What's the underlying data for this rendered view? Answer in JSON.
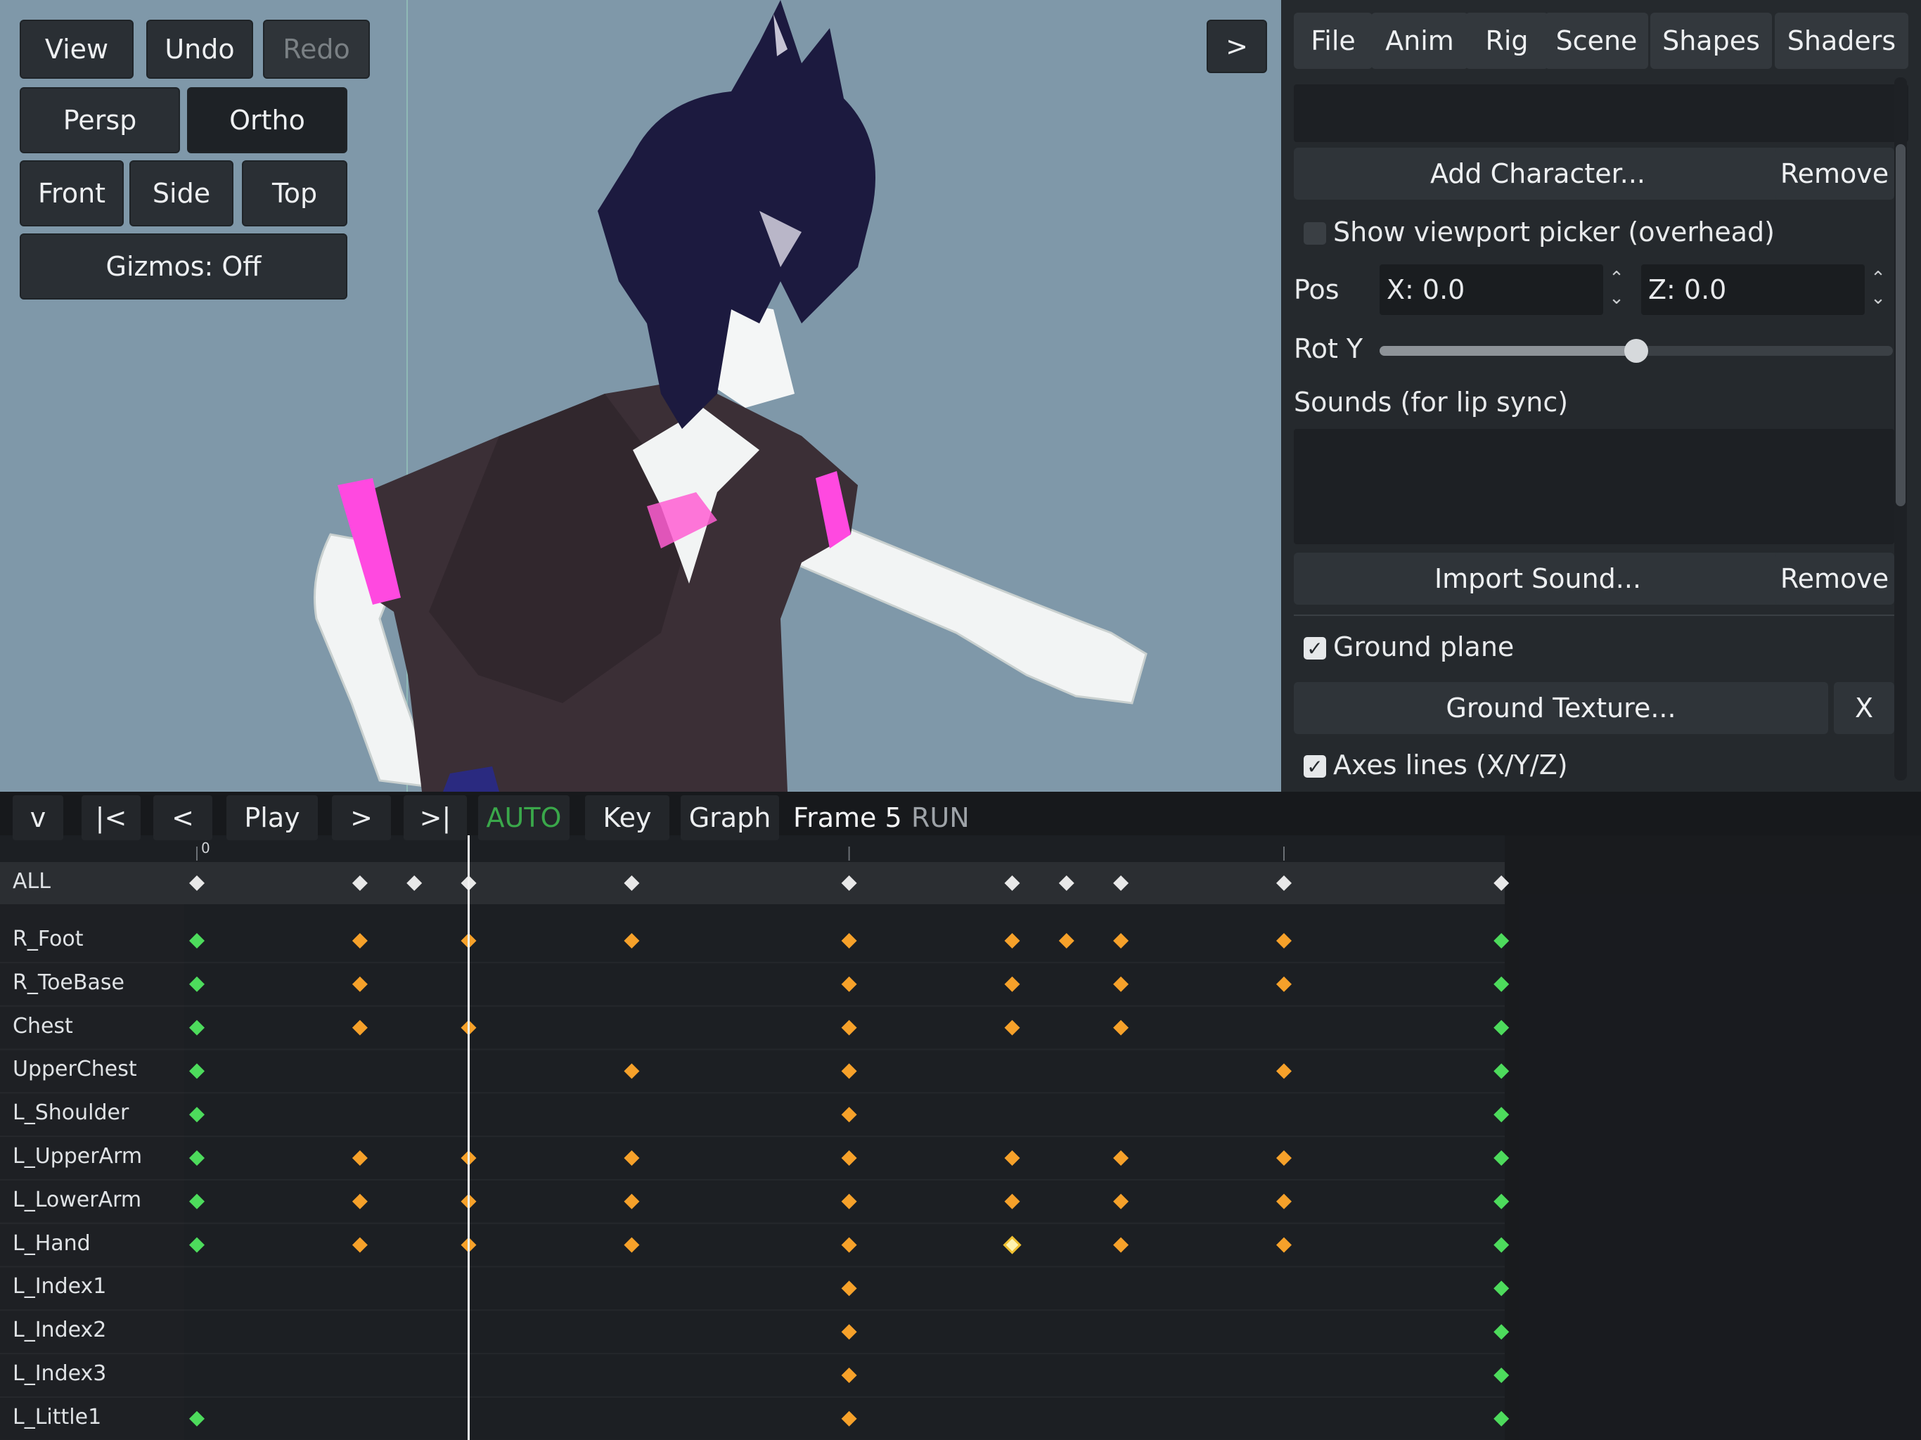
{
  "viewport_toolbar": {
    "view": "View",
    "undo": "Undo",
    "redo": "Redo",
    "persp": "Persp",
    "ortho": "Ortho",
    "front": "Front",
    "side": "Side",
    "top": "Top",
    "gizmos": "Gizmos: Off",
    "expand": ">"
  },
  "panel": {
    "tabs": [
      "File",
      "Anim",
      "Rig",
      "Scene",
      "Shapes",
      "Shaders"
    ],
    "add_character": "Add Character...",
    "remove": "Remove",
    "show_picker": "Show viewport picker (overhead)",
    "pos_label": "Pos",
    "pos_x": "X: 0.0",
    "pos_z": "Z: 0.0",
    "rot_label": "Rot Y",
    "rot_value": 0.5,
    "sounds_label": "Sounds (for lip sync)",
    "import_sound": "Import Sound...",
    "remove2": "Remove",
    "ground_plane": "Ground plane",
    "ground_texture": "Ground Texture...",
    "x_button": "X",
    "axes_lines": "Axes lines (X/Y/Z)"
  },
  "timeline": {
    "collapse": "v",
    "first": "|<",
    "prev": "<",
    "play": "Play",
    "next": ">",
    "last": ">|",
    "auto": "AUTO",
    "key": "Key",
    "graph": "Graph",
    "frame": "Frame 5",
    "run": "RUN",
    "ruler_zero": "0",
    "current_frame": 5,
    "frames": [
      0,
      3,
      4,
      5,
      8,
      12,
      15,
      16,
      17,
      20,
      24
    ],
    "all_label": "ALL",
    "colors": {
      "green": "#4ddb5c",
      "orange": "#f6a12a",
      "white": "#e8e8e8",
      "selected": "#fff3b0",
      "auto": "#3aa84a"
    },
    "rows": [
      {
        "name": "R_Foot",
        "keys": [
          0,
          3,
          5,
          8,
          12,
          15,
          16,
          17,
          20,
          24
        ]
      },
      {
        "name": "R_ToeBase",
        "keys": [
          0,
          3,
          12,
          15,
          17,
          20,
          24
        ]
      },
      {
        "name": "Chest",
        "keys": [
          0,
          3,
          5,
          12,
          15,
          17,
          24
        ]
      },
      {
        "name": "UpperChest",
        "keys": [
          0,
          8,
          12,
          20,
          24
        ]
      },
      {
        "name": "L_Shoulder",
        "keys": [
          0,
          12,
          24
        ]
      },
      {
        "name": "L_UpperArm",
        "keys": [
          0,
          3,
          5,
          8,
          12,
          15,
          17,
          20,
          24
        ]
      },
      {
        "name": "L_LowerArm",
        "keys": [
          0,
          3,
          5,
          8,
          12,
          15,
          17,
          20,
          24
        ]
      },
      {
        "name": "L_Hand",
        "keys": [
          0,
          3,
          5,
          8,
          12,
          15,
          17,
          20,
          24
        ],
        "selected": 15
      },
      {
        "name": "L_Index1",
        "keys": [
          12,
          24
        ]
      },
      {
        "name": "L_Index2",
        "keys": [
          12,
          24
        ]
      },
      {
        "name": "L_Index3",
        "keys": [
          12,
          24
        ]
      },
      {
        "name": "L_Little1",
        "keys": [
          0,
          12,
          24
        ]
      }
    ]
  }
}
